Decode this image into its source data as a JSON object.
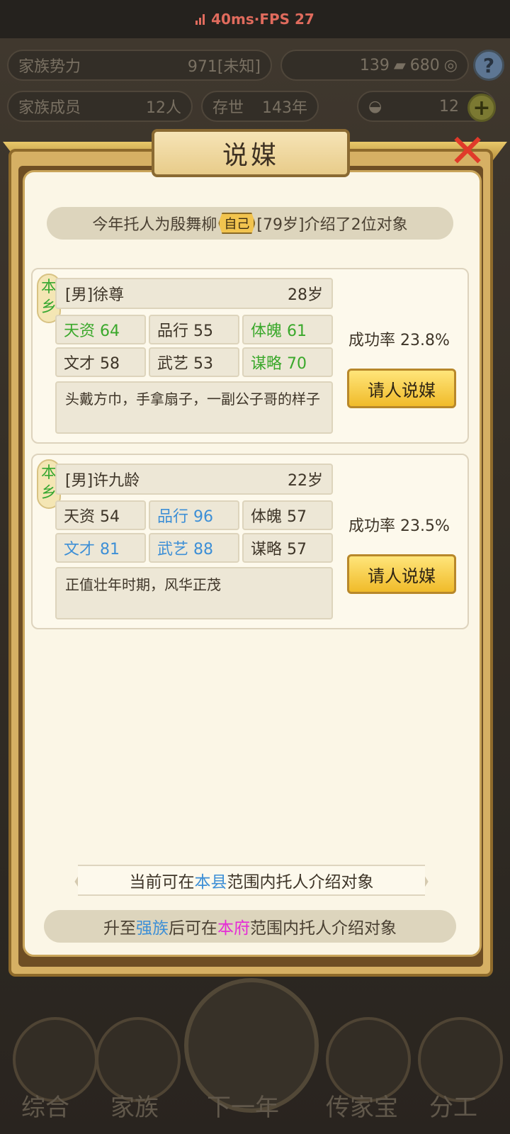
{
  "netbar": {
    "latency": "40ms",
    "sep": " · ",
    "fps": "FPS 27"
  },
  "top": {
    "power_label": "家族势力",
    "power_value": "971",
    "power_rank": "[未知]",
    "silver": "139",
    "coins": "680",
    "members_label": "家族成员",
    "members_value": "12人",
    "survive_label": "存世",
    "survive_value": "143年",
    "gold": "12",
    "help": "?",
    "plus": "+"
  },
  "modal": {
    "title": "说媒",
    "close": "✕",
    "intro_prefix": "今年托人为殷舞柳",
    "intro_tag": "自己",
    "intro_suffix": "[79岁]介绍了2位对象"
  },
  "candidates": [
    {
      "badge": "本乡",
      "name": "[男]徐尊",
      "age": "28岁",
      "stats": [
        {
          "label": "天资 64",
          "color": "green"
        },
        {
          "label": "品行 55",
          "color": "normal"
        },
        {
          "label": "体魄 61",
          "color": "green"
        },
        {
          "label": "文才 58",
          "color": "normal"
        },
        {
          "label": "武艺 53",
          "color": "normal"
        },
        {
          "label": "谋略 70",
          "color": "green"
        }
      ],
      "desc": "头戴方巾，手拿扇子，一副公子哥的样子",
      "rate": "成功率 23.8%",
      "button": "请人说媒"
    },
    {
      "badge": "本乡",
      "name": "[男]许九龄",
      "age": "22岁",
      "stats": [
        {
          "label": "天资 54",
          "color": "normal"
        },
        {
          "label": "品行 96",
          "color": "blue"
        },
        {
          "label": "体魄 57",
          "color": "normal"
        },
        {
          "label": "文才 81",
          "color": "blue"
        },
        {
          "label": "武艺 88",
          "color": "blue"
        },
        {
          "label": "谋略 57",
          "color": "normal"
        }
      ],
      "desc": "正值壮年时期，风华正茂",
      "rate": "成功率 23.5%",
      "button": "请人说媒"
    }
  ],
  "footer": {
    "range_prefix": "当前可在",
    "range_place": "本县",
    "range_suffix": "范围内托人介绍对象",
    "upgrade_prefix": "升至",
    "upgrade_rank": "强族",
    "upgrade_mid": "后可在",
    "upgrade_place": "本府",
    "upgrade_suffix": "范围内托人介绍对象"
  },
  "nav": {
    "general": "综合",
    "family": "家族",
    "next_year": "下一年",
    "heirloom": "传家宝",
    "division": "分工"
  },
  "colors": {
    "accent_green": "#3aa82b",
    "accent_blue": "#3d8fd6",
    "accent_pink": "#e52bd6",
    "button_gold": "#f0bb2a"
  }
}
